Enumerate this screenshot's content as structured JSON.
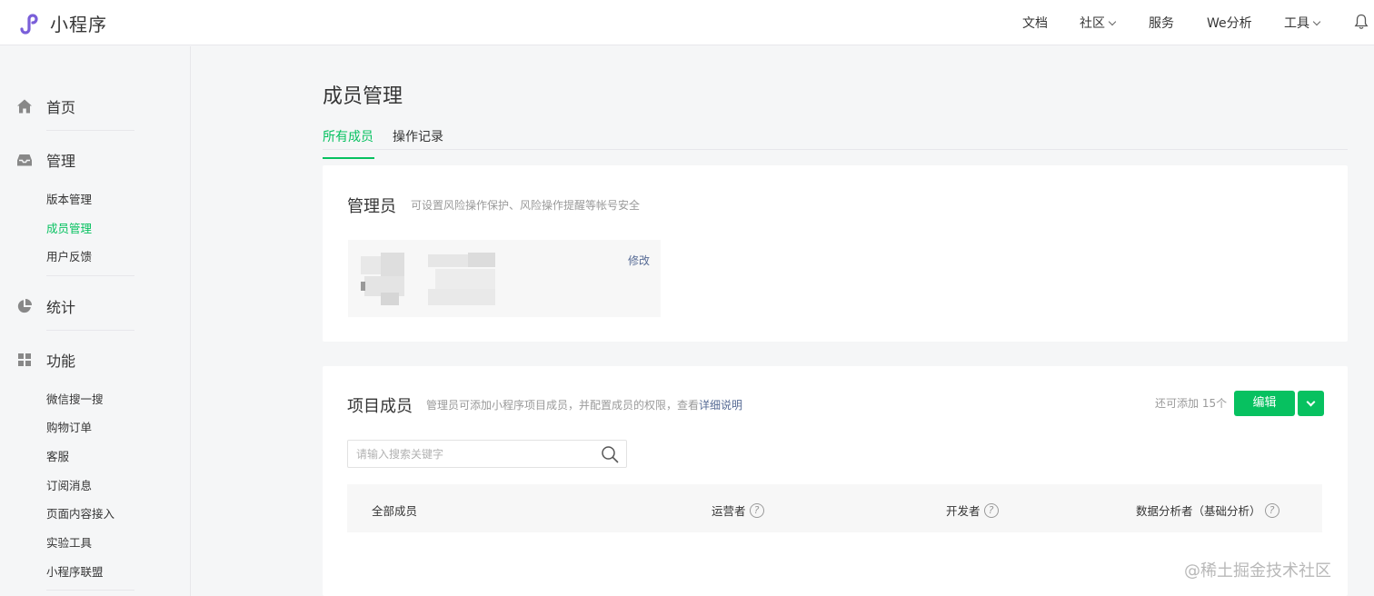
{
  "brand": {
    "name": "小程序",
    "logo_icon": "mini-program-logo-icon",
    "accent": "#7a5fd9"
  },
  "topnav": [
    {
      "label": "文档",
      "has_caret": false
    },
    {
      "label": "社区",
      "has_caret": true
    },
    {
      "label": "服务",
      "has_caret": false
    },
    {
      "label": "We分析",
      "has_caret": false
    },
    {
      "label": "工具",
      "has_caret": true
    }
  ],
  "sidebar": {
    "home": {
      "label": "首页",
      "icon": "home-icon"
    },
    "manage": {
      "label": "管理",
      "icon": "inbox-icon",
      "items": [
        {
          "label": "版本管理",
          "active": false
        },
        {
          "label": "成员管理",
          "active": true
        },
        {
          "label": "用户反馈",
          "active": false
        }
      ]
    },
    "stats": {
      "label": "统计",
      "icon": "pie-chart-icon"
    },
    "features": {
      "label": "功能",
      "icon": "grid-icon",
      "items": [
        {
          "label": "微信搜一搜"
        },
        {
          "label": "购物订单"
        },
        {
          "label": "客服"
        },
        {
          "label": "订阅消息"
        },
        {
          "label": "页面内容接入"
        },
        {
          "label": "实验工具"
        },
        {
          "label": "小程序联盟"
        }
      ]
    }
  },
  "page": {
    "title": "成员管理",
    "tabs": [
      {
        "label": "所有成员",
        "active": true
      },
      {
        "label": "操作记录",
        "active": false
      }
    ]
  },
  "admin_card": {
    "title": "管理员",
    "desc": "可设置风险操作保护、风险操作提醒等帐号安全",
    "modify_label": "修改"
  },
  "members_card": {
    "title": "项目成员",
    "desc_prefix": "管理员可添加小程序项目成员，并配置成员的权限，查看",
    "desc_link": "详细说明",
    "remaining": "还可添加 15个",
    "edit_label": "编辑",
    "search_placeholder": "请输入搜索关键字",
    "columns": [
      {
        "label": "全部成员",
        "help": false
      },
      {
        "label": "运营者",
        "help": true
      },
      {
        "label": "开发者",
        "help": true
      },
      {
        "label": "数据分析者（基础分析）",
        "help": true
      }
    ]
  },
  "watermark": "@稀土掘金技术社区",
  "colors": {
    "green": "#07c160",
    "link": "#576b95",
    "muted": "#9a9a9a"
  }
}
